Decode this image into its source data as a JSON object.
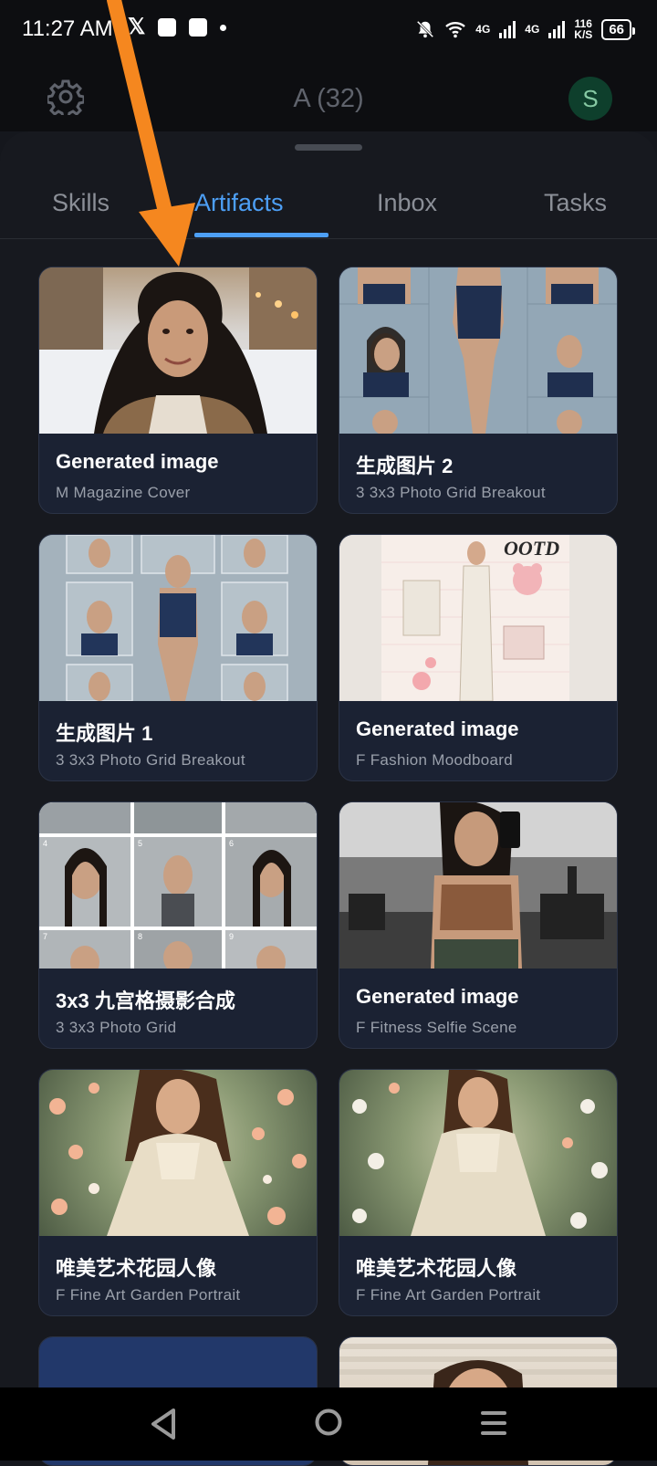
{
  "status_bar": {
    "time": "11:27 AM",
    "x_logo": "𝕏",
    "net_top": "4G",
    "net2_top": "4G",
    "speed_value": "116",
    "speed_unit": "K/S",
    "battery": "66"
  },
  "header": {
    "title": "A (32)",
    "avatar_letter": "S"
  },
  "tabs": [
    {
      "label": "Skills"
    },
    {
      "label": "Artifacts"
    },
    {
      "label": "Inbox"
    },
    {
      "label": "Tasks"
    }
  ],
  "active_tab": "Artifacts",
  "cards": [
    {
      "title": "Generated image",
      "subtitle": "M Magazine Cover"
    },
    {
      "title": "生成图片 2",
      "subtitle": "3 3x3 Photo Grid Breakout"
    },
    {
      "title": "生成图片 1",
      "subtitle": "3 3x3 Photo Grid Breakout"
    },
    {
      "title": "Generated image",
      "subtitle": "F Fashion Moodboard"
    },
    {
      "title": "3x3 九宫格摄影合成",
      "subtitle": "3 3x3 Photo Grid"
    },
    {
      "title": "Generated image",
      "subtitle": "F Fitness Selfie Scene"
    },
    {
      "title": "唯美艺术花园人像",
      "subtitle": "F Fine Art Garden Portrait"
    },
    {
      "title": "唯美艺术花园人像",
      "subtitle": "F Fine Art Garden Portrait"
    }
  ],
  "thumb_labels": {
    "ootd": "OOTD",
    "grid_numbers": [
      "4",
      "5",
      "6",
      "7",
      "8",
      "9"
    ]
  },
  "colors": {
    "accent": "#4d9ff5",
    "annotation_arrow": "#f5871f",
    "card_bg": "#1b2233"
  }
}
